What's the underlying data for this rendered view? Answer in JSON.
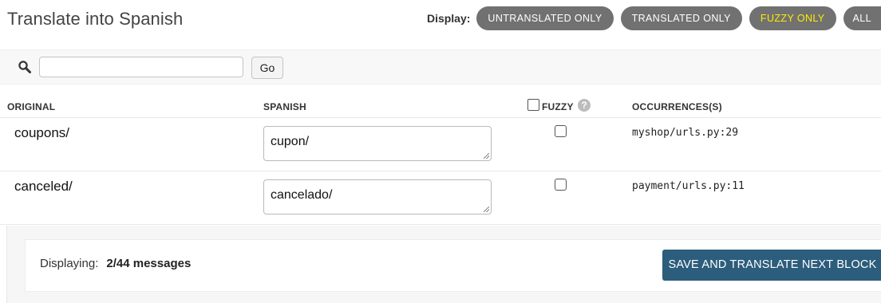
{
  "page": {
    "title": "Translate into Spanish"
  },
  "display_filter": {
    "label": "Display:",
    "options": [
      {
        "label": "UNTRANSLATED ONLY",
        "active": false
      },
      {
        "label": "TRANSLATED ONLY",
        "active": false
      },
      {
        "label": "FUZZY ONLY",
        "active": true
      },
      {
        "label": "ALL",
        "active": false
      }
    ],
    "active_color": "#ffec00",
    "pill_color": "#717171"
  },
  "search": {
    "value": "",
    "go_label": "Go",
    "icon": "search-icon"
  },
  "table": {
    "headers": {
      "original": "ORIGINAL",
      "translation": "SPANISH",
      "fuzzy": "FUZZY",
      "occurrences": "OCCURRENCES(S)"
    },
    "help_icon": "?",
    "rows": [
      {
        "original": "coupons/",
        "translation": "cupon/",
        "fuzzy": false,
        "occurrences": "myshop/urls.py:29"
      },
      {
        "original": "canceled/",
        "translation": "cancelado/",
        "fuzzy": false,
        "occurrences": "payment/urls.py:11"
      }
    ]
  },
  "footer": {
    "displaying_label": "Displaying:",
    "displaying_value": "2/44 messages",
    "save_label": "SAVE AND TRANSLATE NEXT BLOCK",
    "save_color": "#2c5d7c"
  }
}
